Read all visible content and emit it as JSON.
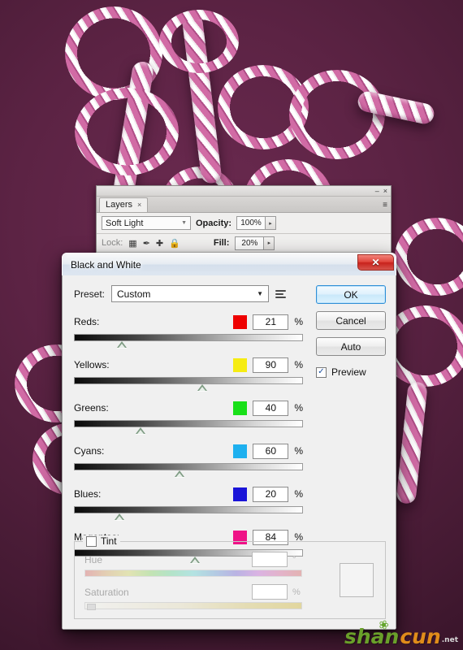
{
  "background": {
    "artwork_description": "candy-cane striped script lettering",
    "base_color": "#5c2344",
    "stripe_pink": "#d16ba5",
    "stripe_white": "#ffffff"
  },
  "layers_panel": {
    "tab_label": "Layers",
    "tab_close": "×",
    "minimize": "–",
    "close": "×",
    "panel_menu": "≡",
    "blend_mode": "Soft Light",
    "blend_arrow": "▼",
    "opacity_label": "Opacity:",
    "opacity_value": "100%",
    "fill_label": "Fill:",
    "fill_value": "20%",
    "lock_label": "Lock:",
    "lock_icons": [
      "⬚",
      "✒",
      "✚",
      "ὑ2"
    ],
    "spin_arrow": "▸"
  },
  "dialog": {
    "title": "Black and White",
    "close_glyph": "✕",
    "preset_label": "Preset:",
    "preset_value": "Custom",
    "preset_arrow": "▼",
    "buttons": {
      "ok": "OK",
      "cancel": "Cancel",
      "auto": "Auto"
    },
    "preview": {
      "label": "Preview",
      "checked": true,
      "check_glyph": "✓"
    },
    "sliders": [
      {
        "name": "Reds:",
        "value": "21",
        "unit": "%",
        "swatch": "#ee0000",
        "pos": 21
      },
      {
        "name": "Yellows:",
        "value": "90",
        "unit": "%",
        "swatch": "#f6ec12",
        "pos": 56
      },
      {
        "name": "Greens:",
        "value": "40",
        "unit": "%",
        "swatch": "#19e019",
        "pos": 29
      },
      {
        "name": "Cyans:",
        "value": "60",
        "unit": "%",
        "swatch": "#1eb0ef",
        "pos": 46
      },
      {
        "name": "Blues:",
        "value": "20",
        "unit": "%",
        "swatch": "#1a14d8",
        "pos": 20
      },
      {
        "name": "Magentas:",
        "value": "84",
        "unit": "%",
        "swatch": "#ef1287",
        "pos": 53
      }
    ],
    "tint": {
      "label": "Tint",
      "checked": false,
      "enabled": false,
      "hue_label": "Hue",
      "hue_value": "",
      "hue_unit": "°",
      "saturation_label": "Saturation",
      "saturation_value": "",
      "saturation_unit": "%"
    }
  },
  "watermark": {
    "part1": "shan",
    "part2": "cun",
    "domain": ".net",
    "leaf": "❀"
  }
}
